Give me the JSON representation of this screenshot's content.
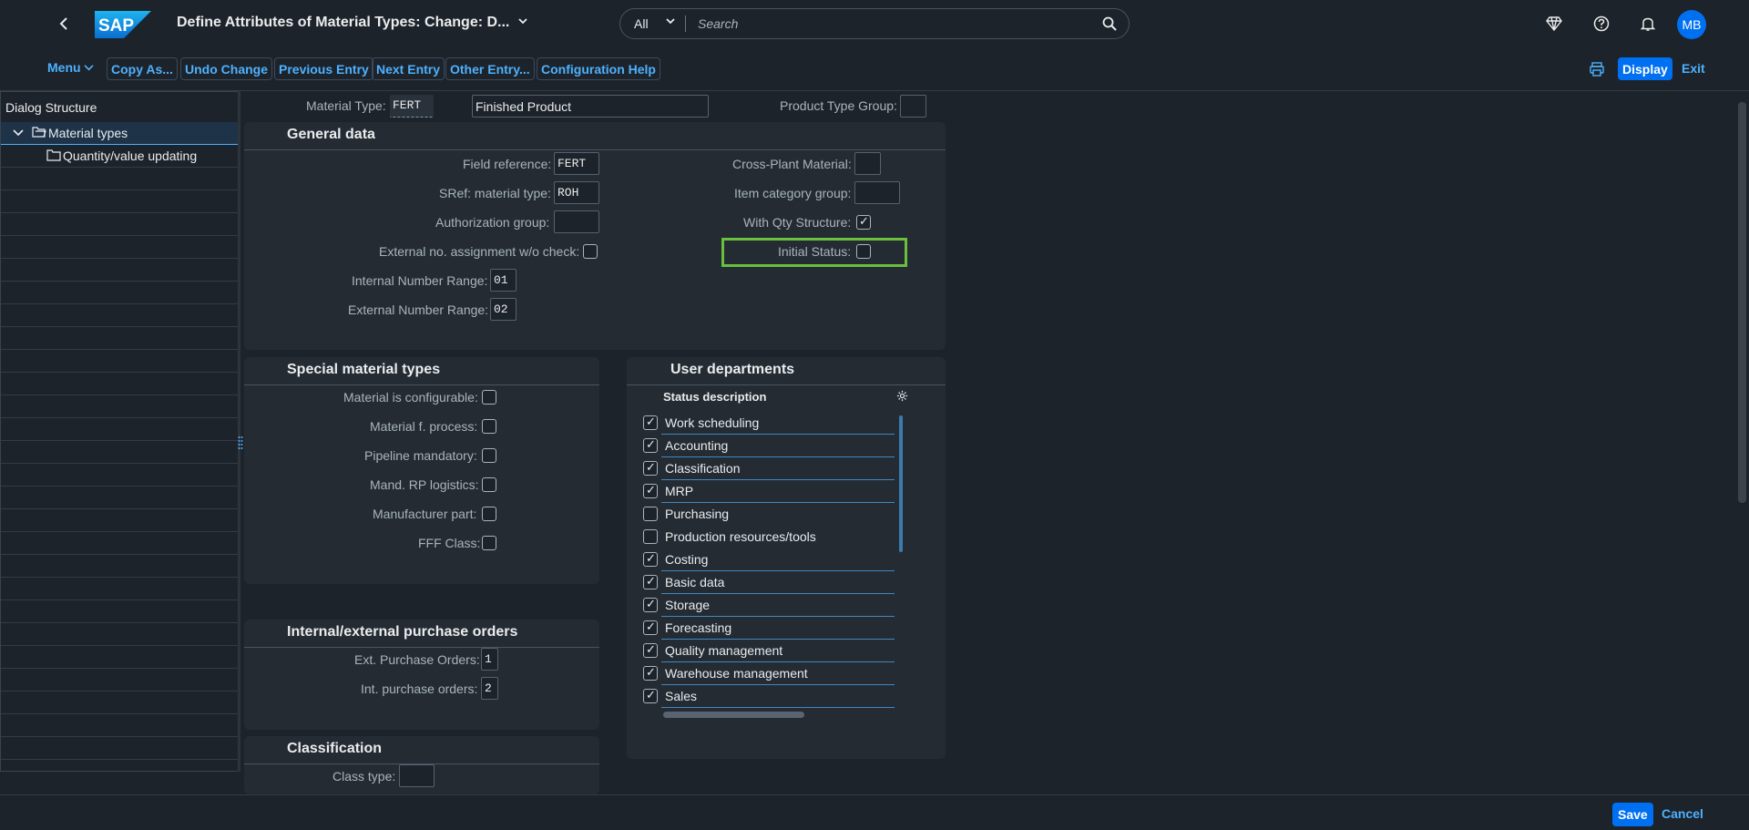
{
  "shell": {
    "logo_text": "SAP",
    "title": "Define Attributes of Material Types: Change: D...",
    "search_scope": "All",
    "search_placeholder": "Search",
    "avatar_initials": "MB"
  },
  "toolbar": {
    "menu": "Menu",
    "buttons": [
      "Copy As...",
      "Undo Change",
      "Previous Entry",
      "Next Entry",
      "Other Entry...",
      "Configuration Help"
    ],
    "display": "Display",
    "exit": "Exit"
  },
  "dialog_structure": {
    "header": "Dialog Structure",
    "items": [
      {
        "label": "Material types",
        "selected": true
      },
      {
        "label": "Quantity/value updating",
        "selected": false
      }
    ]
  },
  "header_fields": {
    "material_type_label": "Material Type:",
    "material_type": "FERT",
    "description": "Finished Product",
    "product_type_group_label": "Product Type Group:",
    "product_type_group": ""
  },
  "general_data": {
    "title": "General data",
    "field_reference_label": "Field reference:",
    "field_reference": "FERT",
    "sref_label": "SRef: material type:",
    "sref": "ROH",
    "auth_group_label": "Authorization group:",
    "auth_group": "",
    "ext_no_label": "External no. assignment w/o check:",
    "int_range_label": "Internal Number Range:",
    "int_range": "01",
    "ext_range_label": "External Number Range:",
    "ext_range": "02",
    "cross_plant_label": "Cross-Plant Material:",
    "cross_plant": "",
    "item_cat_label": "Item category group:",
    "item_cat": "",
    "with_qty_label": "With Qty Structure:",
    "initial_status_label": "Initial Status:"
  },
  "special_material": {
    "title": "Special material types",
    "items": [
      {
        "label": "Material is configurable:",
        "checked": false
      },
      {
        "label": "Material f. process:",
        "checked": false
      },
      {
        "label": "Pipeline mandatory:",
        "checked": false
      },
      {
        "label": "Mand. RP logistics:",
        "checked": false
      },
      {
        "label": "Manufacturer part:",
        "checked": false
      },
      {
        "label": "FFF Class:",
        "checked": false
      }
    ]
  },
  "user_departments": {
    "title": "User departments",
    "column": "Status description",
    "rows": [
      {
        "label": "Work scheduling",
        "checked": true
      },
      {
        "label": "Accounting",
        "checked": true
      },
      {
        "label": "Classification",
        "checked": true
      },
      {
        "label": "MRP",
        "checked": true
      },
      {
        "label": "Purchasing",
        "checked": false
      },
      {
        "label": "Production resources/tools",
        "checked": false
      },
      {
        "label": "Costing",
        "checked": true
      },
      {
        "label": "Basic data",
        "checked": true
      },
      {
        "label": "Storage",
        "checked": true
      },
      {
        "label": "Forecasting",
        "checked": true
      },
      {
        "label": "Quality management",
        "checked": true
      },
      {
        "label": "Warehouse management",
        "checked": true
      },
      {
        "label": "Sales",
        "checked": true
      }
    ]
  },
  "purchase_orders": {
    "title": "Internal/external purchase orders",
    "ext_label": "Ext. Purchase Orders:",
    "ext_value": "1",
    "int_label": "Int. purchase orders:",
    "int_value": "2"
  },
  "classification": {
    "title": "Classification",
    "class_type_label": "Class type:",
    "class_type": ""
  },
  "footer": {
    "save": "Save",
    "cancel": "Cancel"
  }
}
